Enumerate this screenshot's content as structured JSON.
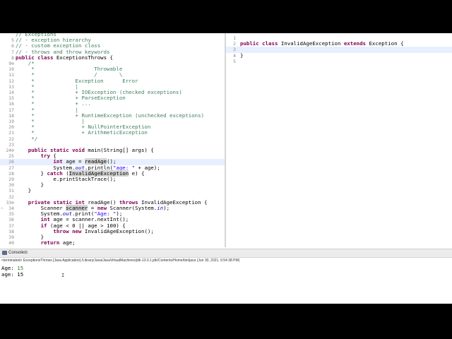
{
  "editor_left": {
    "lines": [
      {
        "num": "",
        "segments": [
          {
            "t": "// Exceptions",
            "c": "cm"
          }
        ]
      },
      {
        "num": "5",
        "segments": [
          {
            "t": "// - exception hierarchy",
            "c": "cm"
          }
        ]
      },
      {
        "num": "6",
        "segments": [
          {
            "t": "// - custom exception class",
            "c": "cm"
          }
        ]
      },
      {
        "num": "7",
        "segments": [
          {
            "t": "// - throws and throw keywords",
            "c": "cm"
          }
        ]
      },
      {
        "num": "8",
        "segments": [
          {
            "t": "public class ",
            "c": "kw"
          },
          {
            "t": "ExceptionsThrows {",
            "c": ""
          }
        ]
      },
      {
        "num": "9⊖",
        "segments": [
          {
            "t": "    /*",
            "c": "cm"
          }
        ]
      },
      {
        "num": "10",
        "segments": [
          {
            "t": "     *                   Throwable",
            "c": "cm"
          }
        ]
      },
      {
        "num": "11",
        "segments": [
          {
            "t": "     *                   /       \\",
            "c": "cm"
          }
        ]
      },
      {
        "num": "12",
        "segments": [
          {
            "t": "     *             Exception      Error",
            "c": "cm"
          }
        ]
      },
      {
        "num": "13",
        "segments": [
          {
            "t": "     *             |",
            "c": "cm"
          }
        ]
      },
      {
        "num": "14",
        "segments": [
          {
            "t": "     *             + IOException (checked exceptions)",
            "c": "cm"
          }
        ]
      },
      {
        "num": "15",
        "segments": [
          {
            "t": "     *             + ParseException",
            "c": "cm"
          }
        ]
      },
      {
        "num": "16",
        "segments": [
          {
            "t": "     *             + ...",
            "c": "cm"
          }
        ]
      },
      {
        "num": "17",
        "segments": [
          {
            "t": "     *             |",
            "c": "cm"
          }
        ]
      },
      {
        "num": "18",
        "segments": [
          {
            "t": "     *             + RuntimeException (unchecked exceptions)",
            "c": "cm"
          }
        ]
      },
      {
        "num": "19",
        "segments": [
          {
            "t": "     *               |",
            "c": "cm"
          }
        ]
      },
      {
        "num": "20",
        "segments": [
          {
            "t": "     *               + NullPointerException",
            "c": "cm"
          }
        ]
      },
      {
        "num": "21",
        "segments": [
          {
            "t": "     *               + ArithmeticException",
            "c": "cm"
          }
        ]
      },
      {
        "num": "22",
        "segments": [
          {
            "t": "     */",
            "c": "cm"
          }
        ]
      },
      {
        "num": "23",
        "segments": [
          {
            "t": "",
            "c": ""
          }
        ]
      },
      {
        "num": "24⊖",
        "segments": [
          {
            "t": "    public static void ",
            "c": "kw"
          },
          {
            "t": "main(String[] args) {",
            "c": ""
          }
        ]
      },
      {
        "num": "25",
        "segments": [
          {
            "t": "        try ",
            "c": "kw"
          },
          {
            "t": "{",
            "c": ""
          }
        ]
      },
      {
        "num": "26",
        "segments": [
          {
            "t": "            ",
            "c": ""
          },
          {
            "t": "int ",
            "c": "kw"
          },
          {
            "t": "age = ",
            "c": ""
          },
          {
            "t": "readAge",
            "c": "mark"
          },
          {
            "t": "();",
            "c": ""
          }
        ],
        "highlight": true
      },
      {
        "num": "27",
        "segments": [
          {
            "t": "            System.",
            "c": ""
          },
          {
            "t": "out",
            "c": "fld"
          },
          {
            "t": ".println(",
            "c": ""
          },
          {
            "t": "\"age: \"",
            "c": "str"
          },
          {
            "t": " + age);",
            "c": ""
          }
        ]
      },
      {
        "num": "28",
        "segments": [
          {
            "t": "        } ",
            "c": ""
          },
          {
            "t": "catch ",
            "c": "kw"
          },
          {
            "t": "(",
            "c": ""
          },
          {
            "t": "InvalidAgeException",
            "c": "mark"
          },
          {
            "t": " e) {",
            "c": ""
          }
        ]
      },
      {
        "num": "29",
        "segments": [
          {
            "t": "            e.printStackTrace();",
            "c": ""
          }
        ]
      },
      {
        "num": "30",
        "segments": [
          {
            "t": "        }",
            "c": ""
          }
        ]
      },
      {
        "num": "31",
        "segments": [
          {
            "t": "    }",
            "c": ""
          }
        ]
      },
      {
        "num": "32",
        "segments": [
          {
            "t": "",
            "c": ""
          }
        ]
      },
      {
        "num": "33⊖",
        "segments": [
          {
            "t": "    private static int ",
            "c": "kw"
          },
          {
            "t": "readAge() ",
            "c": ""
          },
          {
            "t": "throws ",
            "c": "kw"
          },
          {
            "t": "InvalidAgeException {",
            "c": ""
          }
        ]
      },
      {
        "num": "34",
        "segments": [
          {
            "t": "        Scanner ",
            "c": ""
          },
          {
            "t": "scanner",
            "c": "mark"
          },
          {
            "t": " = ",
            "c": ""
          },
          {
            "t": "new ",
            "c": "kw"
          },
          {
            "t": "Scanner(System.",
            "c": ""
          },
          {
            "t": "in",
            "c": "fld"
          },
          {
            "t": ");",
            "c": ""
          }
        ],
        "warn": true
      },
      {
        "num": "35",
        "segments": [
          {
            "t": "        System.",
            "c": ""
          },
          {
            "t": "out",
            "c": "fld"
          },
          {
            "t": ".print(",
            "c": ""
          },
          {
            "t": "\"Age: \"",
            "c": "str"
          },
          {
            "t": ");",
            "c": ""
          }
        ]
      },
      {
        "num": "36",
        "segments": [
          {
            "t": "        ",
            "c": ""
          },
          {
            "t": "int ",
            "c": "kw"
          },
          {
            "t": "age = scanner.nextInt();",
            "c": ""
          }
        ]
      },
      {
        "num": "37",
        "segments": [
          {
            "t": "        ",
            "c": ""
          },
          {
            "t": "if ",
            "c": "kw"
          },
          {
            "t": "(age < 0 || age > 100) {",
            "c": ""
          }
        ]
      },
      {
        "num": "38",
        "segments": [
          {
            "t": "            ",
            "c": ""
          },
          {
            "t": "throw new ",
            "c": "kw"
          },
          {
            "t": "InvalidAgeException();",
            "c": ""
          }
        ]
      },
      {
        "num": "39",
        "segments": [
          {
            "t": "        }",
            "c": ""
          }
        ]
      },
      {
        "num": "40",
        "segments": [
          {
            "t": "        ",
            "c": ""
          },
          {
            "t": "return ",
            "c": "kw"
          },
          {
            "t": "age;",
            "c": ""
          }
        ]
      }
    ]
  },
  "editor_right": {
    "lines": [
      {
        "num": "1",
        "segments": [
          {
            "t": "",
            "c": ""
          }
        ]
      },
      {
        "num": "2",
        "segments": [
          {
            "t": "public class ",
            "c": "kw"
          },
          {
            "t": "InvalidAgeException ",
            "c": ""
          },
          {
            "t": "extends ",
            "c": "kw"
          },
          {
            "t": "Exception {",
            "c": ""
          }
        ]
      },
      {
        "num": "3",
        "segments": [
          {
            "t": "",
            "c": ""
          }
        ],
        "highlight": true
      },
      {
        "num": "4",
        "segments": [
          {
            "t": "}",
            "c": ""
          }
        ]
      },
      {
        "num": "5",
        "segments": [
          {
            "t": "",
            "c": ""
          }
        ]
      }
    ]
  },
  "console": {
    "tab_label": "Console",
    "close_label": "⊠",
    "status": "<terminated> ExceptionsThrows [Java Application] /Library/Java/JavaVirtualMachines/jdk-13.0.1.jdk/Contents/Home/bin/java  (Jun 30, 2021, 6:54:38 PM)",
    "output": [
      {
        "prefix": "Age: ",
        "value": "15"
      },
      {
        "prefix": "age: 15",
        "value": ""
      }
    ]
  }
}
